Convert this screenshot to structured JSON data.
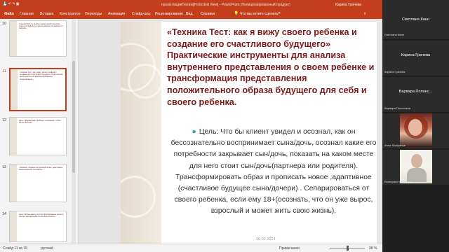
{
  "window": {
    "title": "презентацияТехник[Protected View] - PowerPoint (Нелицензированный продукт)",
    "user": "Карина Грачева",
    "share": "Поделиться"
  },
  "ribbon": {
    "tabs": [
      "Файл",
      "Главная",
      "Вставка",
      "Конструктор",
      "Переходы",
      "Анимация",
      "Слайд-шоу",
      "Рецензирование",
      "Вид",
      "Справка"
    ],
    "search": "Что вы хотите сделать?"
  },
  "thumbnails": [
    {
      "num": "10",
      "text": "Техника NCS 2 и добрых презентаций позволяет понять потребности клиента рабочие потребности и запросы..."
    },
    {
      "num": "11",
      "text": "«Техника Тест: как я вижу своего ребенка и создание его счастливого будущего» Практические инструменты для анализа внутреннего представления..."
    },
    {
      "num": "12",
      "text": "Цель: сформировать ребенка, понимание, чтобы клиент осознал ..."
    },
    {
      "num": "13",
      "text": "«Техника, создание внутренней опоры, адаптивное эмоциональное состояние»"
    },
    {
      "num": "14",
      "text": "Цель: Использовать на этом формирование запроса или при формировании состояния клиента"
    }
  ],
  "slide": {
    "title": "«Техника  Тест: как я вижу своего ребенка и создание его счастливого будущего»",
    "subtitle": "Практические инструменты для анализа внутреннего представления о своем ребенке и трансформация представления положительного образа будущего для себя и своего ребенка.",
    "body": "Цель: Что бы клиент увидел и осознал, как  он бессознательно воспринимает сына/дочь, осознал какие его потребности закрывает сын/дочь, показать на каком месте для него стоит сын/дочь(партнера или родителя). Трансформировать образ и прописать новое ,адаптивное (счастливое будущее сына/дочери) . Сепарироваться от своего ребенка, если ему 18+(осознать, что он уже вырос, взрослый и может жить свою жизнь).",
    "date": "16.02.2024",
    "number": "11"
  },
  "statusbar": {
    "slide_info": "Слайд 11 из 15",
    "language": "русский",
    "notes": "Примечания",
    "zoom": "98 %"
  },
  "participants": [
    {
      "name": "Светлана Канн",
      "label": "Светлана Канн"
    },
    {
      "name": "Карина Грачева",
      "label": "Карина Грачева"
    },
    {
      "name": "Варвара  Полонс...",
      "label": "Варвара Полонская"
    },
    {
      "label": "Anna Shalyakina"
    },
    {
      "label": "Екатерина Ротанова"
    }
  ]
}
